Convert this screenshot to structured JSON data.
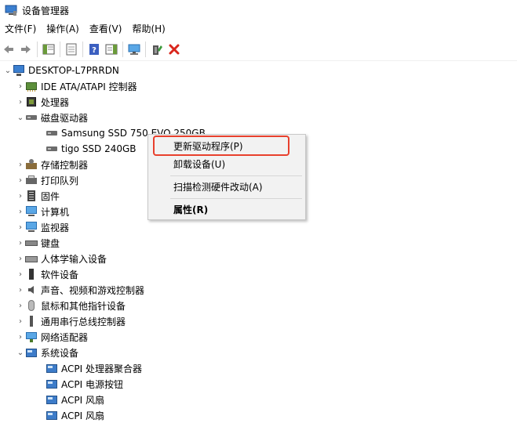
{
  "window": {
    "title": "设备管理器"
  },
  "menu": [
    "文件(F)",
    "操作(A)",
    "查看(V)",
    "帮助(H)"
  ],
  "colors": {
    "highlight_border": "#e8402d",
    "delete_icon": "#d9261c",
    "menu_bg": "#f2f2f2"
  },
  "tree": {
    "root": "DESKTOP-L7PRRDN",
    "items": [
      {
        "label": "IDE ATA/ATAPI 控制器",
        "icon": "ide-controller-icon",
        "expanded": false
      },
      {
        "label": "处理器",
        "icon": "processor-icon",
        "expanded": false
      },
      {
        "label": "磁盘驱动器",
        "icon": "disk-drive-icon",
        "expanded": true
      },
      {
        "label": "Samsung SSD 750 EVO 250GB",
        "icon": "disk-icon"
      },
      {
        "label": "tigo SSD 240GB",
        "icon": "disk-icon"
      },
      {
        "label": "存储控制器",
        "icon": "storage-controller-icon",
        "expanded": false
      },
      {
        "label": "打印队列",
        "icon": "printer-icon",
        "expanded": false
      },
      {
        "label": "固件",
        "icon": "firmware-icon",
        "expanded": false
      },
      {
        "label": "计算机",
        "icon": "computer-icon",
        "expanded": false
      },
      {
        "label": "监视器",
        "icon": "monitor-icon",
        "expanded": false
      },
      {
        "label": "键盘",
        "icon": "keyboard-icon",
        "expanded": false
      },
      {
        "label": "人体学输入设备",
        "icon": "hid-icon",
        "expanded": false
      },
      {
        "label": "软件设备",
        "icon": "software-device-icon",
        "expanded": false
      },
      {
        "label": "声音、视频和游戏控制器",
        "icon": "speaker-icon",
        "expanded": false
      },
      {
        "label": "鼠标和其他指针设备",
        "icon": "mouse-icon",
        "expanded": false
      },
      {
        "label": "通用串行总线控制器",
        "icon": "usb-icon",
        "expanded": false
      },
      {
        "label": "网络适配器",
        "icon": "network-adapter-icon",
        "expanded": false
      },
      {
        "label": "系统设备",
        "icon": "system-device-icon",
        "expanded": true
      },
      {
        "label": "ACPI 处理器聚合器",
        "icon": "acpi-icon"
      },
      {
        "label": "ACPI 电源按钮",
        "icon": "acpi-icon"
      },
      {
        "label": "ACPI 风扇",
        "icon": "acpi-icon"
      },
      {
        "label": "ACPI 风扇",
        "icon": "acpi-icon"
      }
    ]
  },
  "context_menu": {
    "update_driver": "更新驱动程序(P)",
    "uninstall": "卸载设备(U)",
    "scan": "扫描检测硬件改动(A)",
    "properties": "属性(R)"
  }
}
